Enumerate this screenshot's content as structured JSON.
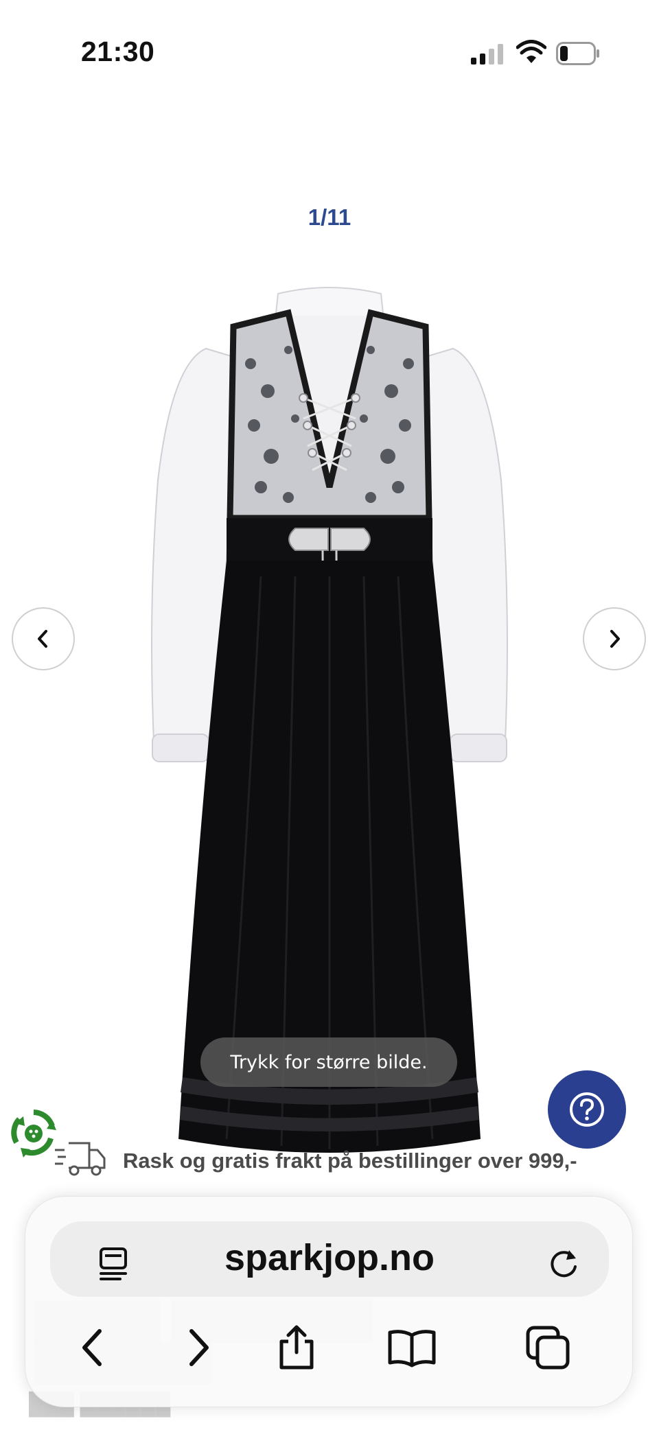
{
  "status_bar": {
    "time": "21:30"
  },
  "gallery": {
    "counter": "1/11",
    "tap_hint": "Trykk for større bilde."
  },
  "shipping": {
    "text": "Rask og gratis frakt på bestillinger over 999,-"
  },
  "browser": {
    "url": "sparkjop.no"
  },
  "icons": [
    "signal-icon",
    "wifi-icon",
    "battery-icon",
    "chevron-left-icon",
    "chevron-right-icon",
    "help-icon",
    "eco-badge-icon",
    "truck-icon",
    "reader-icon",
    "reload-icon",
    "back-icon",
    "forward-icon",
    "share-icon",
    "bookmarks-icon",
    "tabs-icon"
  ],
  "colors": {
    "brand": "#2a3f8f",
    "counter": "#2e4a8f",
    "text_gray": "#4b4b4b"
  }
}
